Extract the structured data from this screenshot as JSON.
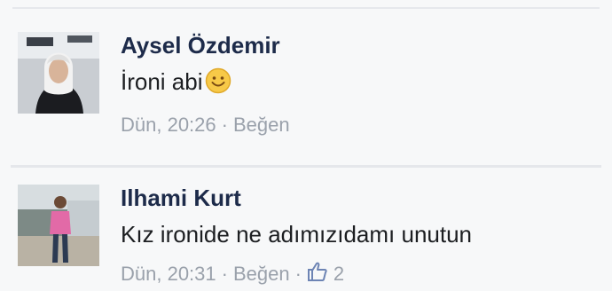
{
  "comments": [
    {
      "author": "Aysel Özdemir",
      "text": "İroni abi",
      "emoji": "smile-emoji",
      "time": "Dün, 20:26",
      "separator": "·",
      "like_label": "Beğen"
    },
    {
      "author": "Ilhami Kurt",
      "text": "Kız ironide ne adımızıdamı unutun",
      "time": "Dün, 20:31",
      "separator": "·",
      "like_label": "Beğen",
      "separator2": "·",
      "like_count": "2"
    }
  ],
  "colors": {
    "author": "#1d2b4a",
    "meta": "#9aa1ab",
    "emoji_fill": "#f7c948",
    "like_icon": "#6d84b4"
  }
}
